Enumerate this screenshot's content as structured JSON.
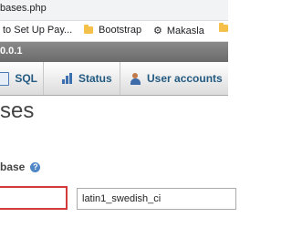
{
  "browser": {
    "url_text": "bases.php"
  },
  "bookmarks": [
    {
      "label": "to Set Up Pay...",
      "icon": "page-icon"
    },
    {
      "label": "Bootstrap",
      "icon": "folder-icon"
    },
    {
      "label": "Makasla",
      "icon": "gear-icon"
    }
  ],
  "server": {
    "address_fragment": "0.0.1"
  },
  "tabs": [
    {
      "label": "SQL",
      "icon": "sql-icon"
    },
    {
      "label": "Status",
      "icon": "status-icon"
    },
    {
      "label": "User accounts",
      "icon": "users-icon"
    }
  ],
  "page": {
    "heading_fragment": "ses",
    "create_label_fragment": "base",
    "help_glyph": "?"
  },
  "form": {
    "database_name_value": "",
    "collation_value": "latin1_swedish_ci"
  },
  "colors": {
    "highlight_border": "#d23b3b",
    "tab_text": "#235a81",
    "server_bar": "#7a7a7a"
  }
}
